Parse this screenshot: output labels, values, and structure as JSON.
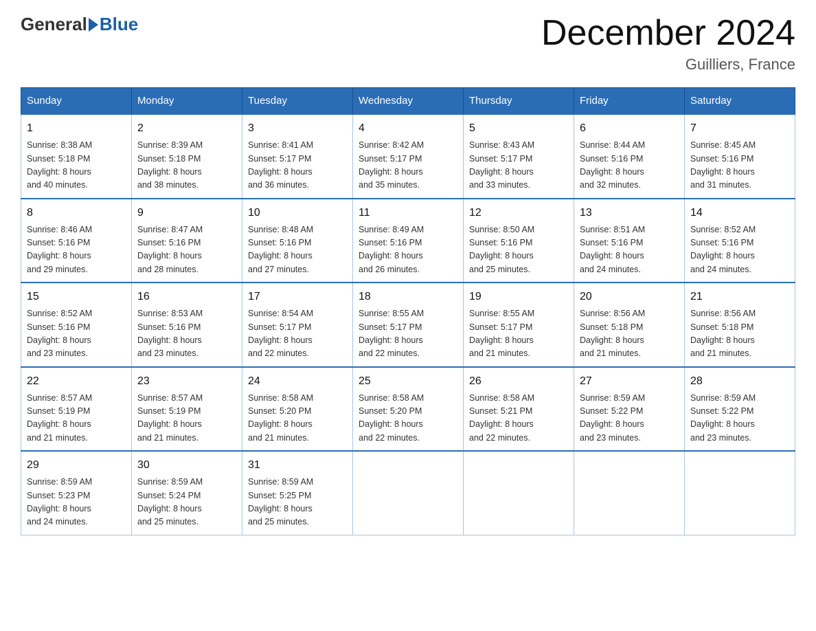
{
  "header": {
    "logo_general": "General",
    "logo_blue": "Blue",
    "month_title": "December 2024",
    "location": "Guilliers, France"
  },
  "weekdays": [
    "Sunday",
    "Monday",
    "Tuesday",
    "Wednesday",
    "Thursday",
    "Friday",
    "Saturday"
  ],
  "weeks": [
    [
      {
        "day": "1",
        "info": "Sunrise: 8:38 AM\nSunset: 5:18 PM\nDaylight: 8 hours\nand 40 minutes."
      },
      {
        "day": "2",
        "info": "Sunrise: 8:39 AM\nSunset: 5:18 PM\nDaylight: 8 hours\nand 38 minutes."
      },
      {
        "day": "3",
        "info": "Sunrise: 8:41 AM\nSunset: 5:17 PM\nDaylight: 8 hours\nand 36 minutes."
      },
      {
        "day": "4",
        "info": "Sunrise: 8:42 AM\nSunset: 5:17 PM\nDaylight: 8 hours\nand 35 minutes."
      },
      {
        "day": "5",
        "info": "Sunrise: 8:43 AM\nSunset: 5:17 PM\nDaylight: 8 hours\nand 33 minutes."
      },
      {
        "day": "6",
        "info": "Sunrise: 8:44 AM\nSunset: 5:16 PM\nDaylight: 8 hours\nand 32 minutes."
      },
      {
        "day": "7",
        "info": "Sunrise: 8:45 AM\nSunset: 5:16 PM\nDaylight: 8 hours\nand 31 minutes."
      }
    ],
    [
      {
        "day": "8",
        "info": "Sunrise: 8:46 AM\nSunset: 5:16 PM\nDaylight: 8 hours\nand 29 minutes."
      },
      {
        "day": "9",
        "info": "Sunrise: 8:47 AM\nSunset: 5:16 PM\nDaylight: 8 hours\nand 28 minutes."
      },
      {
        "day": "10",
        "info": "Sunrise: 8:48 AM\nSunset: 5:16 PM\nDaylight: 8 hours\nand 27 minutes."
      },
      {
        "day": "11",
        "info": "Sunrise: 8:49 AM\nSunset: 5:16 PM\nDaylight: 8 hours\nand 26 minutes."
      },
      {
        "day": "12",
        "info": "Sunrise: 8:50 AM\nSunset: 5:16 PM\nDaylight: 8 hours\nand 25 minutes."
      },
      {
        "day": "13",
        "info": "Sunrise: 8:51 AM\nSunset: 5:16 PM\nDaylight: 8 hours\nand 24 minutes."
      },
      {
        "day": "14",
        "info": "Sunrise: 8:52 AM\nSunset: 5:16 PM\nDaylight: 8 hours\nand 24 minutes."
      }
    ],
    [
      {
        "day": "15",
        "info": "Sunrise: 8:52 AM\nSunset: 5:16 PM\nDaylight: 8 hours\nand 23 minutes."
      },
      {
        "day": "16",
        "info": "Sunrise: 8:53 AM\nSunset: 5:16 PM\nDaylight: 8 hours\nand 23 minutes."
      },
      {
        "day": "17",
        "info": "Sunrise: 8:54 AM\nSunset: 5:17 PM\nDaylight: 8 hours\nand 22 minutes."
      },
      {
        "day": "18",
        "info": "Sunrise: 8:55 AM\nSunset: 5:17 PM\nDaylight: 8 hours\nand 22 minutes."
      },
      {
        "day": "19",
        "info": "Sunrise: 8:55 AM\nSunset: 5:17 PM\nDaylight: 8 hours\nand 21 minutes."
      },
      {
        "day": "20",
        "info": "Sunrise: 8:56 AM\nSunset: 5:18 PM\nDaylight: 8 hours\nand 21 minutes."
      },
      {
        "day": "21",
        "info": "Sunrise: 8:56 AM\nSunset: 5:18 PM\nDaylight: 8 hours\nand 21 minutes."
      }
    ],
    [
      {
        "day": "22",
        "info": "Sunrise: 8:57 AM\nSunset: 5:19 PM\nDaylight: 8 hours\nand 21 minutes."
      },
      {
        "day": "23",
        "info": "Sunrise: 8:57 AM\nSunset: 5:19 PM\nDaylight: 8 hours\nand 21 minutes."
      },
      {
        "day": "24",
        "info": "Sunrise: 8:58 AM\nSunset: 5:20 PM\nDaylight: 8 hours\nand 21 minutes."
      },
      {
        "day": "25",
        "info": "Sunrise: 8:58 AM\nSunset: 5:20 PM\nDaylight: 8 hours\nand 22 minutes."
      },
      {
        "day": "26",
        "info": "Sunrise: 8:58 AM\nSunset: 5:21 PM\nDaylight: 8 hours\nand 22 minutes."
      },
      {
        "day": "27",
        "info": "Sunrise: 8:59 AM\nSunset: 5:22 PM\nDaylight: 8 hours\nand 23 minutes."
      },
      {
        "day": "28",
        "info": "Sunrise: 8:59 AM\nSunset: 5:22 PM\nDaylight: 8 hours\nand 23 minutes."
      }
    ],
    [
      {
        "day": "29",
        "info": "Sunrise: 8:59 AM\nSunset: 5:23 PM\nDaylight: 8 hours\nand 24 minutes."
      },
      {
        "day": "30",
        "info": "Sunrise: 8:59 AM\nSunset: 5:24 PM\nDaylight: 8 hours\nand 25 minutes."
      },
      {
        "day": "31",
        "info": "Sunrise: 8:59 AM\nSunset: 5:25 PM\nDaylight: 8 hours\nand 25 minutes."
      },
      null,
      null,
      null,
      null
    ]
  ]
}
